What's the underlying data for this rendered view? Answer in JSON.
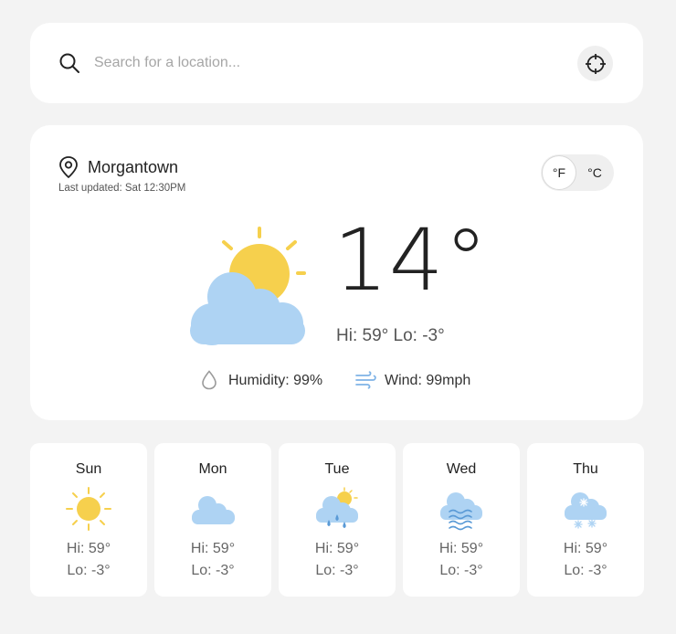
{
  "search": {
    "placeholder": "Search for a location...",
    "value": "",
    "icon": "search-icon",
    "locate_icon": "crosshair-icon"
  },
  "current": {
    "location": "Morgantown",
    "last_updated": "Last updated: Sat 12:30PM",
    "temperature": "14°",
    "hi_lo": "Hi: 59° Lo: -3°",
    "condition_icon": "partly-cloudy-icon",
    "humidity": "Humidity: 99%",
    "wind": "Wind: 99mph",
    "units": {
      "f": "°F",
      "c": "°C",
      "selected": "f"
    }
  },
  "colors": {
    "background": "#f3f3f3",
    "card": "#ffffff",
    "sun": "#f6d04d",
    "cloud": "#aed3f3",
    "rain": "#5a9ad6"
  },
  "forecast": [
    {
      "day": "Sun",
      "hi": "Hi: 59°",
      "lo": "Lo: -3°",
      "icon": "sunny-icon"
    },
    {
      "day": "Mon",
      "hi": "Hi: 59°",
      "lo": "Lo: -3°",
      "icon": "cloudy-icon"
    },
    {
      "day": "Tue",
      "hi": "Hi: 59°",
      "lo": "Lo: -3°",
      "icon": "rain-icon"
    },
    {
      "day": "Wed",
      "hi": "Hi: 59°",
      "lo": "Lo: -3°",
      "icon": "wind-icon"
    },
    {
      "day": "Thu",
      "hi": "Hi: 59°",
      "lo": "Lo: -3°",
      "icon": "snow-icon"
    }
  ]
}
